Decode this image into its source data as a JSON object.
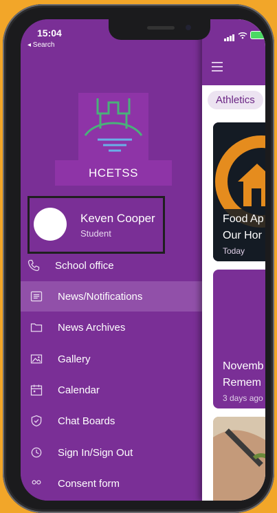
{
  "status_bar": {
    "time": "15:04",
    "back_label": "◂ Search"
  },
  "drawer": {
    "school_name": "HCETSS",
    "profile": {
      "name": "Keven Cooper",
      "role": "Student"
    },
    "menu": [
      {
        "label": "School office",
        "icon": "phone-icon"
      },
      {
        "label": "News/Notifications",
        "icon": "newspaper-icon",
        "active": true
      },
      {
        "label": "News Archives",
        "icon": "folder-icon"
      },
      {
        "label": "Gallery",
        "icon": "image-icon"
      },
      {
        "label": "Calendar",
        "icon": "calendar-icon"
      },
      {
        "label": "Chat Boards",
        "icon": "shield-icon"
      },
      {
        "label": "Sign In/Sign Out",
        "icon": "clock-icon"
      },
      {
        "label": "Consent form",
        "icon": "consent-icon"
      }
    ]
  },
  "main": {
    "filter_chip": "Athletics",
    "cards": [
      {
        "title_line1": "Food Ap",
        "title_line2": "Our Hor",
        "date": "Today"
      },
      {
        "title_line1": "Novemb",
        "title_line2": "Remem",
        "date": "3 days ago"
      }
    ]
  },
  "colors": {
    "brand_purple": "#7a2f96",
    "active_row": "#9150a9",
    "background": "#f2a629"
  }
}
